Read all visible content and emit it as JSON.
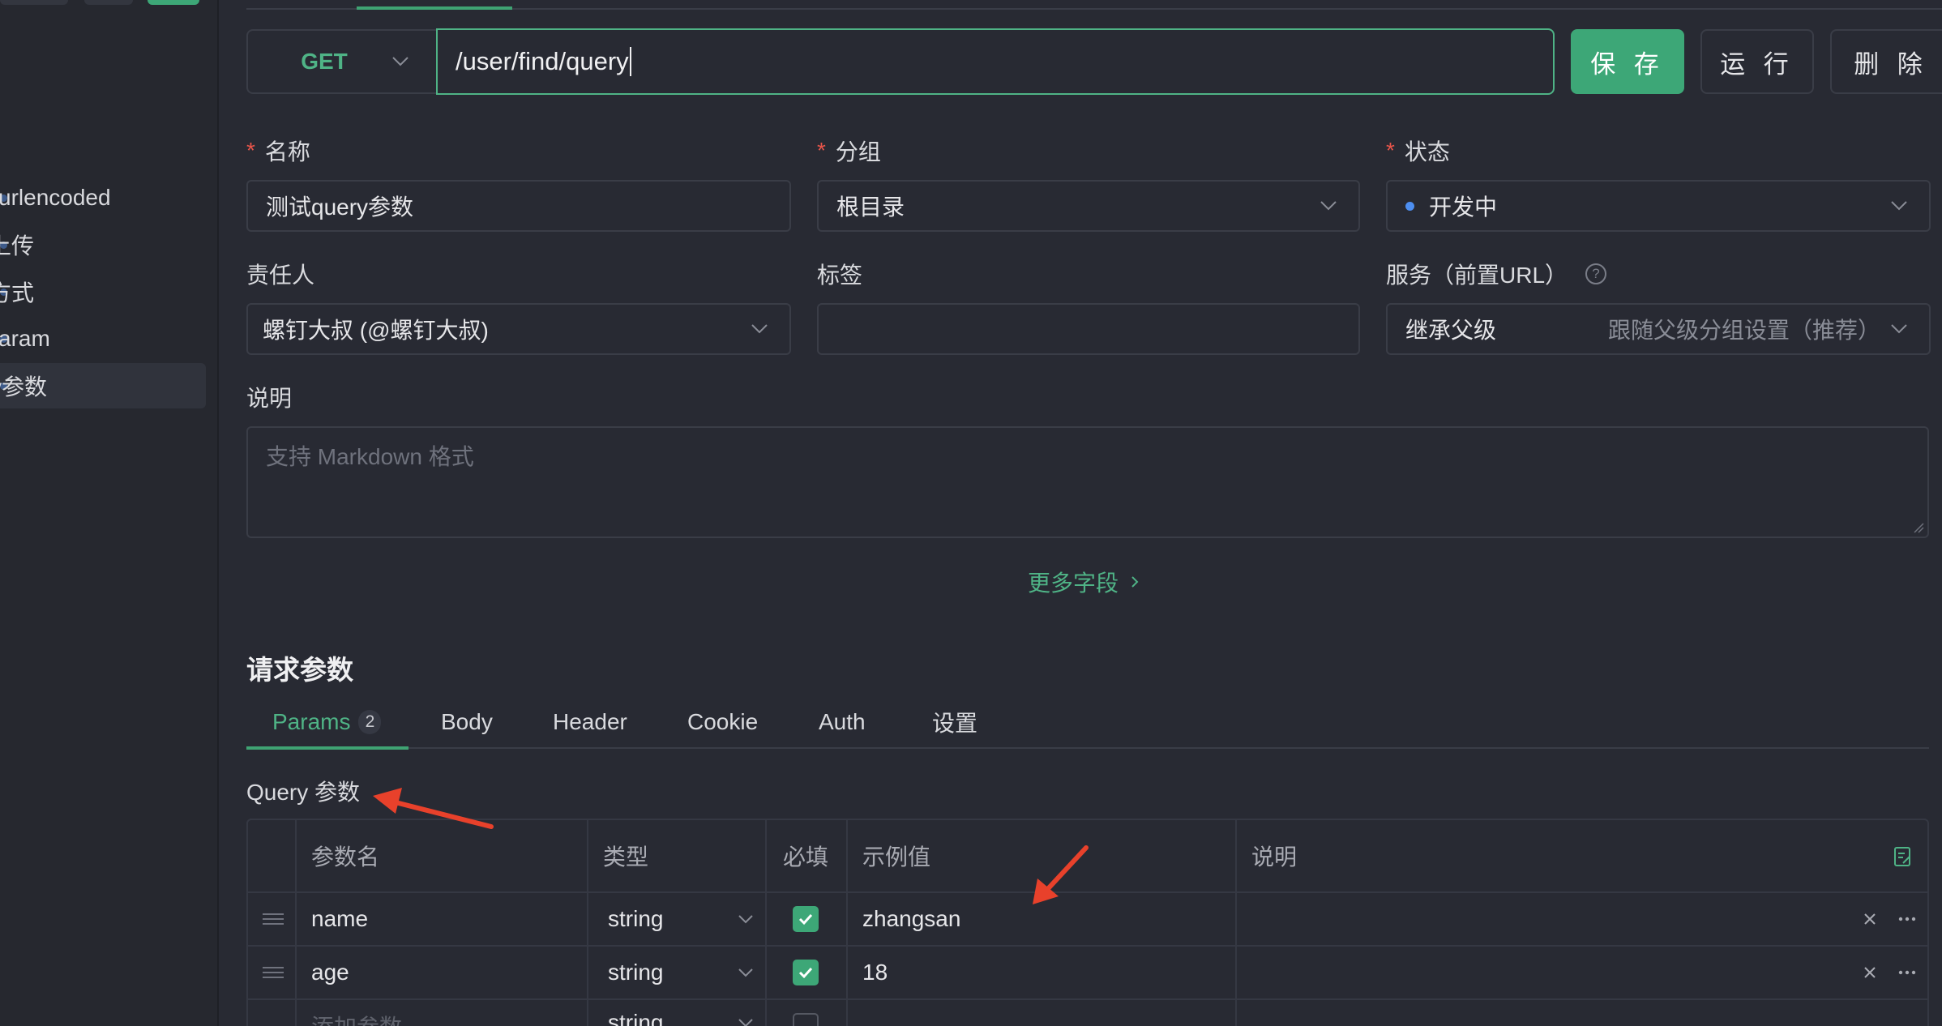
{
  "sidebar": {
    "items": [
      {
        "label": "urlencoded"
      },
      {
        "label": "上传"
      },
      {
        "label": "方式"
      },
      {
        "label": "aram"
      },
      {
        "label": "y参数"
      }
    ]
  },
  "url_bar": {
    "method": "GET",
    "path": "/user/find/query",
    "save_label": "保 存",
    "run_label": "运 行",
    "delete_label": "删 除"
  },
  "form": {
    "name_label": "名称",
    "name_value": "测试query参数",
    "group_label": "分组",
    "group_value": "根目录",
    "status_label": "状态",
    "status_value": "开发中",
    "owner_label": "责任人",
    "owner_value": "螺钉大叔 (@螺钉大叔)",
    "tags_label": "标签",
    "tags_value": "",
    "service_label": "服务（前置URL）",
    "service_value": "继承父级",
    "service_hint": "跟随父级分组设置（推荐）",
    "desc_label": "说明",
    "desc_placeholder": "支持 Markdown 格式",
    "more_fields": "更多字段",
    "required_mark": "*",
    "help_mark": "?"
  },
  "params": {
    "section_title": "请求参数",
    "tabs": [
      {
        "label": "Params",
        "badge": "2"
      },
      {
        "label": "Body"
      },
      {
        "label": "Header"
      },
      {
        "label": "Cookie"
      },
      {
        "label": "Auth"
      },
      {
        "label": "设置"
      }
    ],
    "query_label": "Query 参数",
    "columns": [
      "参数名",
      "类型",
      "必填",
      "示例值",
      "说明"
    ],
    "rows": [
      {
        "name": "name",
        "type": "string",
        "required": true,
        "example": "zhangsan",
        "desc": ""
      },
      {
        "name": "age",
        "type": "string",
        "required": true,
        "example": "18",
        "desc": ""
      }
    ],
    "new_row": {
      "name_placeholder": "添加参数",
      "type": "string"
    }
  },
  "colors": {
    "accent": "#3da777",
    "annotation_arrow": "#e8412b",
    "status_dot": "#4d8ef0"
  }
}
